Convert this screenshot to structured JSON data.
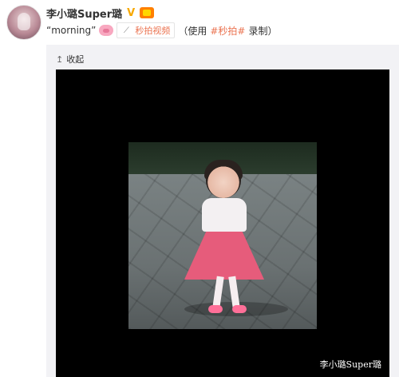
{
  "post": {
    "username": "李小璐Super璐",
    "text_quote": "“morning”",
    "video_tag_label": "秒拍视频",
    "note_prefix": "（使用",
    "topic": "#秒拍#",
    "note_suffix": "录制）"
  },
  "card": {
    "collapse_label": "收起",
    "collapse_icon": "↥"
  },
  "video": {
    "watermark": "李小璐Super璐"
  },
  "icons": {
    "verified": "V",
    "link": "⟋"
  },
  "colors": {
    "accent": "#eb7350",
    "verified": "#f7a800",
    "card_bg": "#f2f2f5",
    "player_bg": "#000000"
  }
}
